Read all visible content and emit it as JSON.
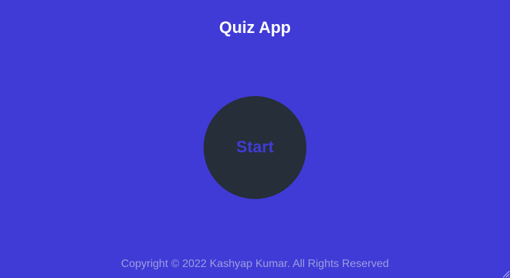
{
  "header": {
    "title": "Quiz App"
  },
  "main": {
    "start_label": "Start"
  },
  "footer": {
    "copyright": "Copyright © 2022 Kashyap Kumar. All Rights Reserved"
  },
  "colors": {
    "background": "#403bd6",
    "button_background": "#252e39",
    "button_text": "#403bd6",
    "title_text": "#ffffff",
    "footer_text": "#9d9ee0"
  },
  "icons": {
    "corner": "resize-handle-icon"
  }
}
